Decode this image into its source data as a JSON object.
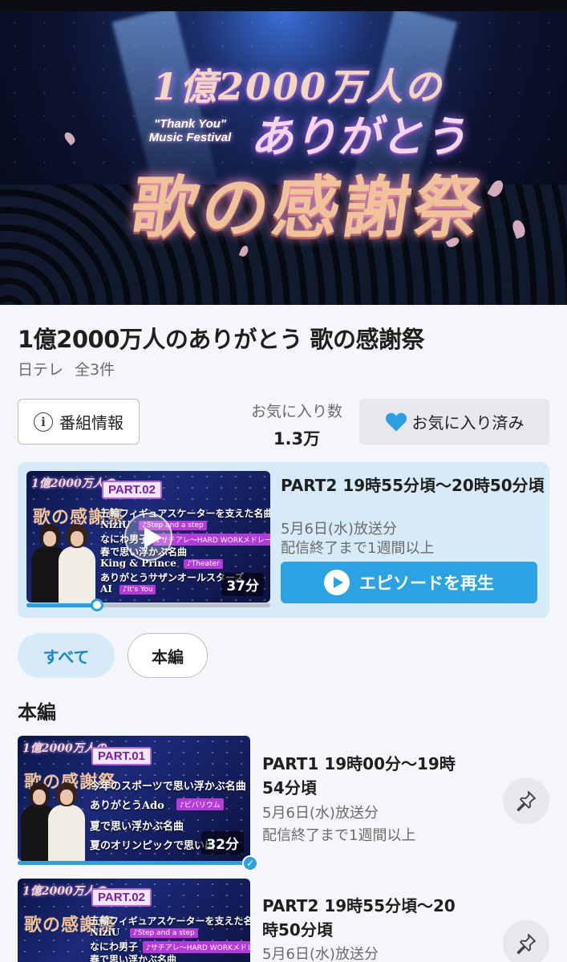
{
  "hero": {
    "line1": "1億2000万人の",
    "line2": "ありがとう",
    "english": "\"Thank You\" Music Festival",
    "line3": "歌の感謝祭"
  },
  "show": {
    "title": "1億2000万人のありがとう 歌の感謝祭",
    "network": "日テレ",
    "count": "全3件"
  },
  "actions": {
    "info_label": "番組情報",
    "fav_count_label": "お気に入り数",
    "fav_count_value": "1.3万",
    "fav_button_label": "お気に入り済み"
  },
  "featured": {
    "thumb_part": "PART.02",
    "thumb_lines": [
      "五輪フィギュアスケーターを支えた名曲",
      "NiziU",
      "なにわ男子",
      "春で思い浮かぶ名曲",
      "King & Prince",
      "ありがとうサザンオールスターズ",
      "AI"
    ],
    "thumb_chips": [
      "♪Step and a step",
      "♪サチアレ〜HARD WORKメドレー",
      "♪Theater",
      "♪It's You"
    ],
    "title": "PART2 19時55分頃〜20時50分頃",
    "broadcast": "5月6日(水)放送分",
    "availability": "配信終了まで1週間以上",
    "duration": "37分",
    "progress": 0.29,
    "play_label": "エピソードを再生"
  },
  "filters": {
    "all": "すべて",
    "main": "本編"
  },
  "section": {
    "title": "本編"
  },
  "episodes": [
    {
      "thumb_part": "PART.01",
      "thumb_lines": [
        "今年のスポーツで思い浮かぶ名曲",
        "ありがとうAdo",
        "夏で思い浮かぶ名曲",
        "夏のオリンピックで思い出"
      ],
      "thumb_chips": [
        "♪ビバリウム"
      ],
      "title_line1": "PART1 19時00分〜19時",
      "title_line2": "54分頃",
      "broadcast": "5月6日(水)放送分",
      "availability": "配信終了まで1週間以上",
      "duration": "32分",
      "progress": 1.0,
      "watched": true
    },
    {
      "thumb_part": "PART.02",
      "thumb_lines": [
        "五輪フィギュアスケーターを支えた名曲",
        "NiziU",
        "なにわ男子",
        "春で思い浮かぶ名曲"
      ],
      "thumb_chips": [
        "♪Step and a step",
        "♪サチアレ〜HARD WORKメドレー"
      ],
      "title_line1": "PART2 19時55分頃〜20",
      "title_line2": "時50分頃",
      "broadcast": "5月6日(水)放送分",
      "watched": false
    }
  ],
  "colors": {
    "accent": "#2ba3e2",
    "card_bg": "#d6ebf7",
    "heart": "#2aa0e0"
  }
}
